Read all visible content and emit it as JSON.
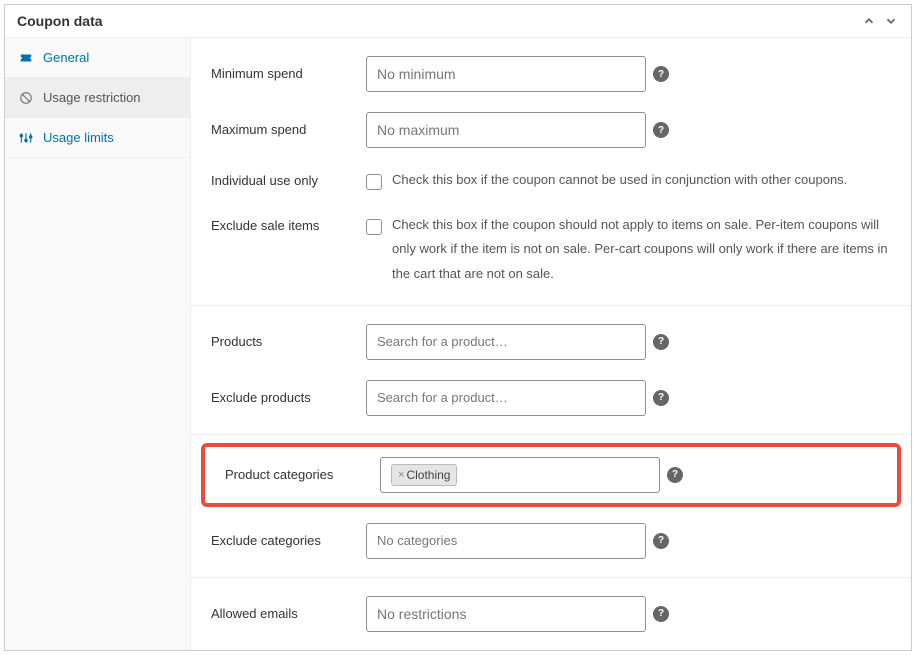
{
  "panel": {
    "title": "Coupon data"
  },
  "sidebar": {
    "items": [
      {
        "label": "General"
      },
      {
        "label": "Usage restriction"
      },
      {
        "label": "Usage limits"
      }
    ]
  },
  "fields": {
    "min_spend": {
      "label": "Minimum spend",
      "placeholder": "No minimum"
    },
    "max_spend": {
      "label": "Maximum spend",
      "placeholder": "No maximum"
    },
    "individual_use": {
      "label": "Individual use only",
      "desc": "Check this box if the coupon cannot be used in conjunction with other coupons."
    },
    "exclude_sale": {
      "label": "Exclude sale items",
      "desc": "Check this box if the coupon should not apply to items on sale. Per-item coupons will only work if the item is not on sale. Per-cart coupons will only work if there are items in the cart that are not on sale."
    },
    "products": {
      "label": "Products",
      "placeholder": "Search for a product…"
    },
    "exclude_products": {
      "label": "Exclude products",
      "placeholder": "Search for a product…"
    },
    "product_categories": {
      "label": "Product categories",
      "tag": "Clothing"
    },
    "exclude_categories": {
      "label": "Exclude categories",
      "placeholder": "No categories"
    },
    "allowed_emails": {
      "label": "Allowed emails",
      "placeholder": "No restrictions"
    }
  }
}
